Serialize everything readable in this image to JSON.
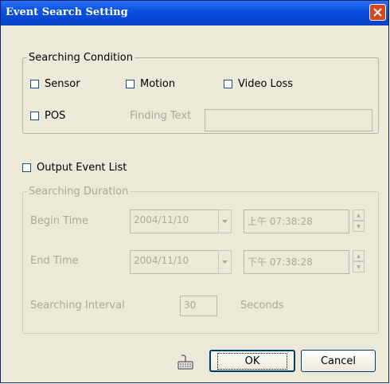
{
  "window": {
    "title": "Event Search Setting",
    "close_icon": "close-icon"
  },
  "searching_condition": {
    "legend": "Searching Condition",
    "sensor": {
      "label": "Sensor",
      "checked": false
    },
    "motion": {
      "label": "Motion",
      "checked": false
    },
    "video_loss": {
      "label": "Video Loss",
      "checked": false
    },
    "pos": {
      "label": "POS",
      "checked": false
    },
    "finding_text_label": "Finding Text",
    "finding_text_value": ""
  },
  "output_event_list": {
    "label": "Output Event List",
    "checked": false
  },
  "searching_duration": {
    "legend": "Searching Duration",
    "begin_label": "Begin Time",
    "begin_date": "2004/11/10",
    "begin_time": "上午 07:38:28",
    "end_label": "End Time",
    "end_date": "2004/11/10",
    "end_time": "下午 07:38:28",
    "interval_label": "Searching Interval",
    "interval_value": "30",
    "interval_unit": "Seconds"
  },
  "buttons": {
    "keyboard_icon": "keyboard-icon",
    "ok": "OK",
    "cancel": "Cancel"
  },
  "colors": {
    "title_bar": "#0a52e0",
    "dialog_bg": "#ece9d8",
    "disabled_text": "#aca899",
    "close_button": "#d9451c"
  }
}
